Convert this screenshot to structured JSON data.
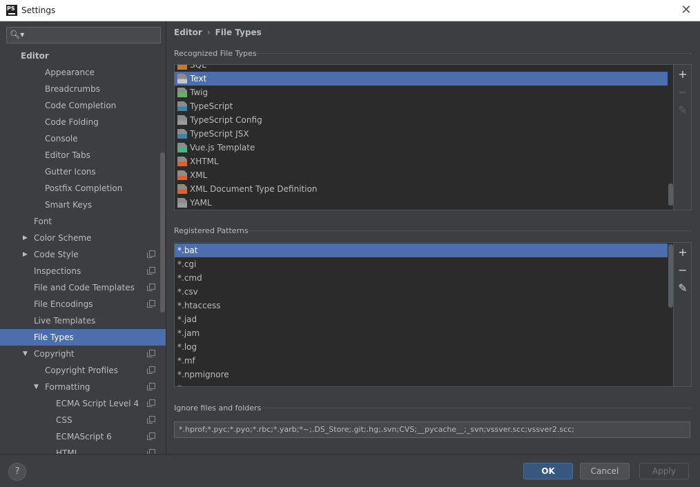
{
  "window": {
    "title": "Settings",
    "app_icon_text": "PS",
    "close_glyph": "✕"
  },
  "search": {
    "placeholder": "",
    "icon": "search-icon"
  },
  "sidebar": {
    "items": [
      {
        "label": "Editor",
        "indent": 0,
        "bold": true
      },
      {
        "label": "Appearance",
        "indent": 2
      },
      {
        "label": "Breadcrumbs",
        "indent": 2
      },
      {
        "label": "Code Completion",
        "indent": 2
      },
      {
        "label": "Code Folding",
        "indent": 2
      },
      {
        "label": "Console",
        "indent": 2
      },
      {
        "label": "Editor Tabs",
        "indent": 2
      },
      {
        "label": "Gutter Icons",
        "indent": 2
      },
      {
        "label": "Postfix Completion",
        "indent": 2
      },
      {
        "label": "Smart Keys",
        "indent": 2
      },
      {
        "label": "Font",
        "indent": 1
      },
      {
        "label": "Color Scheme",
        "indent": 1,
        "arrow": "▶"
      },
      {
        "label": "Code Style",
        "indent": 1,
        "arrow": "▶",
        "copy": true
      },
      {
        "label": "Inspections",
        "indent": 1,
        "copy": true
      },
      {
        "label": "File and Code Templates",
        "indent": 1,
        "copy": true
      },
      {
        "label": "File Encodings",
        "indent": 1,
        "copy": true
      },
      {
        "label": "Live Templates",
        "indent": 1
      },
      {
        "label": "File Types",
        "indent": 1,
        "selected": true
      },
      {
        "label": "Copyright",
        "indent": 1,
        "arrow": "▼",
        "copy": true
      },
      {
        "label": "Copyright Profiles",
        "indent": 2,
        "copy": true
      },
      {
        "label": "Formatting",
        "indent": 2,
        "arrow": "▼",
        "copy": true
      },
      {
        "label": "ECMA Script Level 4",
        "indent": 3,
        "copy": true
      },
      {
        "label": "CSS",
        "indent": 3,
        "copy": true
      },
      {
        "label": "ECMAScript 6",
        "indent": 3,
        "copy": true
      },
      {
        "label": "HTML",
        "indent": 3,
        "copy": true
      }
    ]
  },
  "breadcrumb": {
    "parent": "Editor",
    "separator": "›",
    "current": "File Types"
  },
  "recognized": {
    "title": "Recognized File Types",
    "items": [
      {
        "label": "SQL",
        "icon": "sql-file-icon",
        "color": "#c27c2e"
      },
      {
        "label": "Text",
        "icon": "text-file-icon",
        "color": "#c8c8c8",
        "selected": true
      },
      {
        "label": "Twig",
        "icon": "twig-file-icon",
        "color": "#5cb85c"
      },
      {
        "label": "TypeScript",
        "icon": "typescript-file-icon",
        "color": "#3a87ad"
      },
      {
        "label": "TypeScript Config",
        "icon": "typescript-config-file-icon",
        "color": "#9a9a9a"
      },
      {
        "label": "TypeScript JSX",
        "icon": "typescript-jsx-file-icon",
        "color": "#3a87ad"
      },
      {
        "label": "Vue.js Template",
        "icon": "vue-file-icon",
        "color": "#41b883"
      },
      {
        "label": "XHTML",
        "icon": "xhtml-file-icon",
        "color": "#e06030"
      },
      {
        "label": "XML",
        "icon": "xml-file-icon",
        "color": "#e06030"
      },
      {
        "label": "XML Document Type Definition",
        "icon": "dtd-file-icon",
        "color": "#e06030"
      },
      {
        "label": "YAML",
        "icon": "yaml-file-icon",
        "color": "#9a9a9a"
      }
    ]
  },
  "patterns": {
    "title": "Registered Patterns",
    "items": [
      {
        "label": "*.bat",
        "selected": true
      },
      {
        "label": "*.cgi"
      },
      {
        "label": "*.cmd"
      },
      {
        "label": "*.csv"
      },
      {
        "label": "*.htaccess"
      },
      {
        "label": "*.jad"
      },
      {
        "label": "*.jam"
      },
      {
        "label": "*.log"
      },
      {
        "label": "*.mf"
      },
      {
        "label": "*.npmignore"
      },
      {
        "label": "*."
      }
    ]
  },
  "ignore": {
    "title": "Ignore files and folders",
    "value": "*.hprof;*.pyc;*.pyo;*.rbc;*.yarb;*~;.DS_Store;.git;.hg;.svn;CVS;__pycache__;_svn;vssver.scc;vssver2.scc;"
  },
  "tools": {
    "add": "+",
    "remove": "−",
    "edit": "✎"
  },
  "footer": {
    "help": "?",
    "ok": "OK",
    "cancel": "Cancel",
    "apply": "Apply"
  },
  "colors": {
    "accent": "#4b6eaf",
    "ok_button": "#365880",
    "background": "#3c3f41",
    "list_background": "#2b2b2b"
  }
}
